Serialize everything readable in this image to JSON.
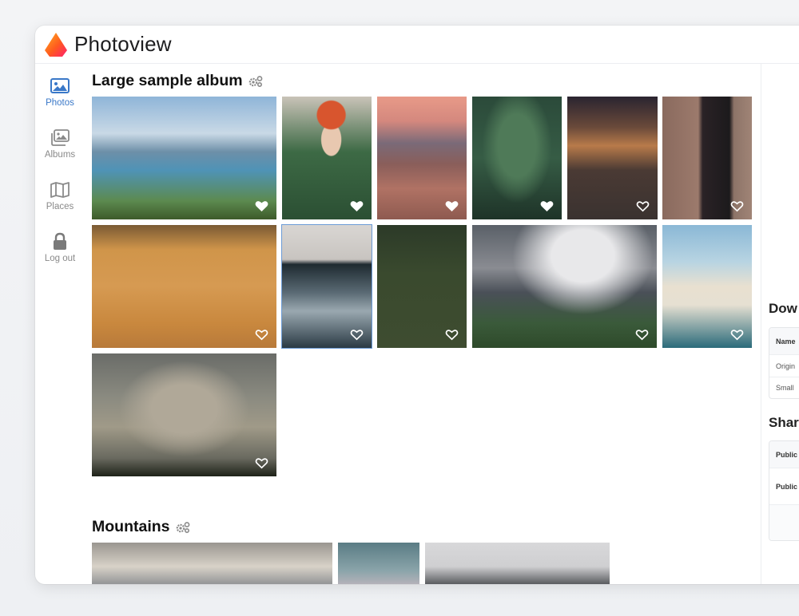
{
  "app": {
    "title": "Photoview"
  },
  "sidebar": {
    "items": [
      {
        "label": "Photos",
        "icon": "photo-icon",
        "active": true
      },
      {
        "label": "Albums",
        "icon": "albums-icon",
        "active": false
      },
      {
        "label": "Places",
        "icon": "map-icon",
        "active": false
      },
      {
        "label": "Log out",
        "icon": "lock-icon",
        "active": false
      }
    ]
  },
  "colors": {
    "accent": "#3a78c8",
    "selected_border": "#6b9bd6"
  },
  "albums": [
    {
      "title": "Large sample album",
      "settings_icon": "gears-icon",
      "photos": [
        {
          "name": "bridge-city",
          "favorite": true
        },
        {
          "name": "woman-green-sweater",
          "favorite": true
        },
        {
          "name": "pink-sea-waves",
          "favorite": true
        },
        {
          "name": "fern-hand",
          "favorite": true
        },
        {
          "name": "night-street",
          "favorite": false
        },
        {
          "name": "woman-balcony",
          "favorite": false
        },
        {
          "name": "wall-mural",
          "favorite": false
        },
        {
          "name": "waterfall",
          "favorite": false,
          "selected": true
        },
        {
          "name": "tennis-court",
          "favorite": false
        },
        {
          "name": "volcano",
          "favorite": false
        },
        {
          "name": "island-beach",
          "favorite": false
        },
        {
          "name": "misty-mountain",
          "favorite": false
        }
      ]
    },
    {
      "title": "Mountains",
      "settings_icon": "gears-icon",
      "photos": [
        {
          "name": "valley-mountains"
        },
        {
          "name": "snowy-peak-clouds"
        },
        {
          "name": "snowy-ridge-fog"
        }
      ]
    }
  ],
  "sidebar_panel": {
    "download_heading": "Dow",
    "download_rows": [
      "Name",
      "Origin",
      "Small"
    ],
    "sharing_heading": "Shari",
    "sharing_rows": [
      "Public",
      "Public",
      ""
    ]
  }
}
